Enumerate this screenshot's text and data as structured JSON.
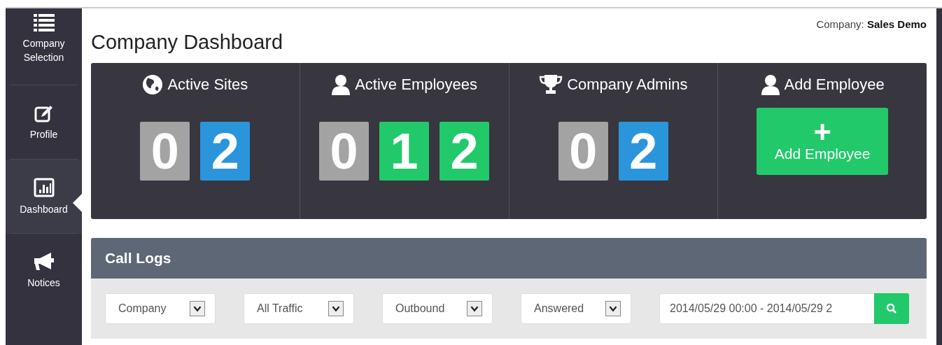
{
  "sidebar": {
    "items": [
      {
        "label": "Company Selection",
        "selected": false
      },
      {
        "label": "Profile",
        "selected": false
      },
      {
        "label": "Dashboard",
        "selected": true
      },
      {
        "label": "Notices",
        "selected": false
      }
    ]
  },
  "header": {
    "title": "Company Dashboard",
    "company_label": "Company:",
    "company_name": "Sales Demo"
  },
  "stats": [
    {
      "kind": "counter",
      "title": "Active Sites",
      "digits": [
        {
          "text": "0",
          "color": "#a3a3a3"
        },
        {
          "text": "2",
          "color": "#2b95dc"
        }
      ]
    },
    {
      "kind": "counter",
      "title": "Active Employees",
      "digits": [
        {
          "text": "0",
          "color": "#a3a3a3"
        },
        {
          "text": "1",
          "color": "#22c96a"
        },
        {
          "text": "2",
          "color": "#22c96a"
        }
      ]
    },
    {
      "kind": "counter",
      "title": "Company Admins",
      "digits": [
        {
          "text": "0",
          "color": "#a3a3a3"
        },
        {
          "text": "2",
          "color": "#2b95dc"
        }
      ]
    },
    {
      "kind": "action",
      "title": "Add Employee",
      "button_icon": "+",
      "button_label": "Add Employee"
    }
  ],
  "call_logs": {
    "title": "Call Logs",
    "filters": [
      "Company",
      "All Traffic",
      "Outbound",
      "Answered"
    ],
    "date_range": "2014/05/29 00:00 - 2014/05/29 2"
  }
}
